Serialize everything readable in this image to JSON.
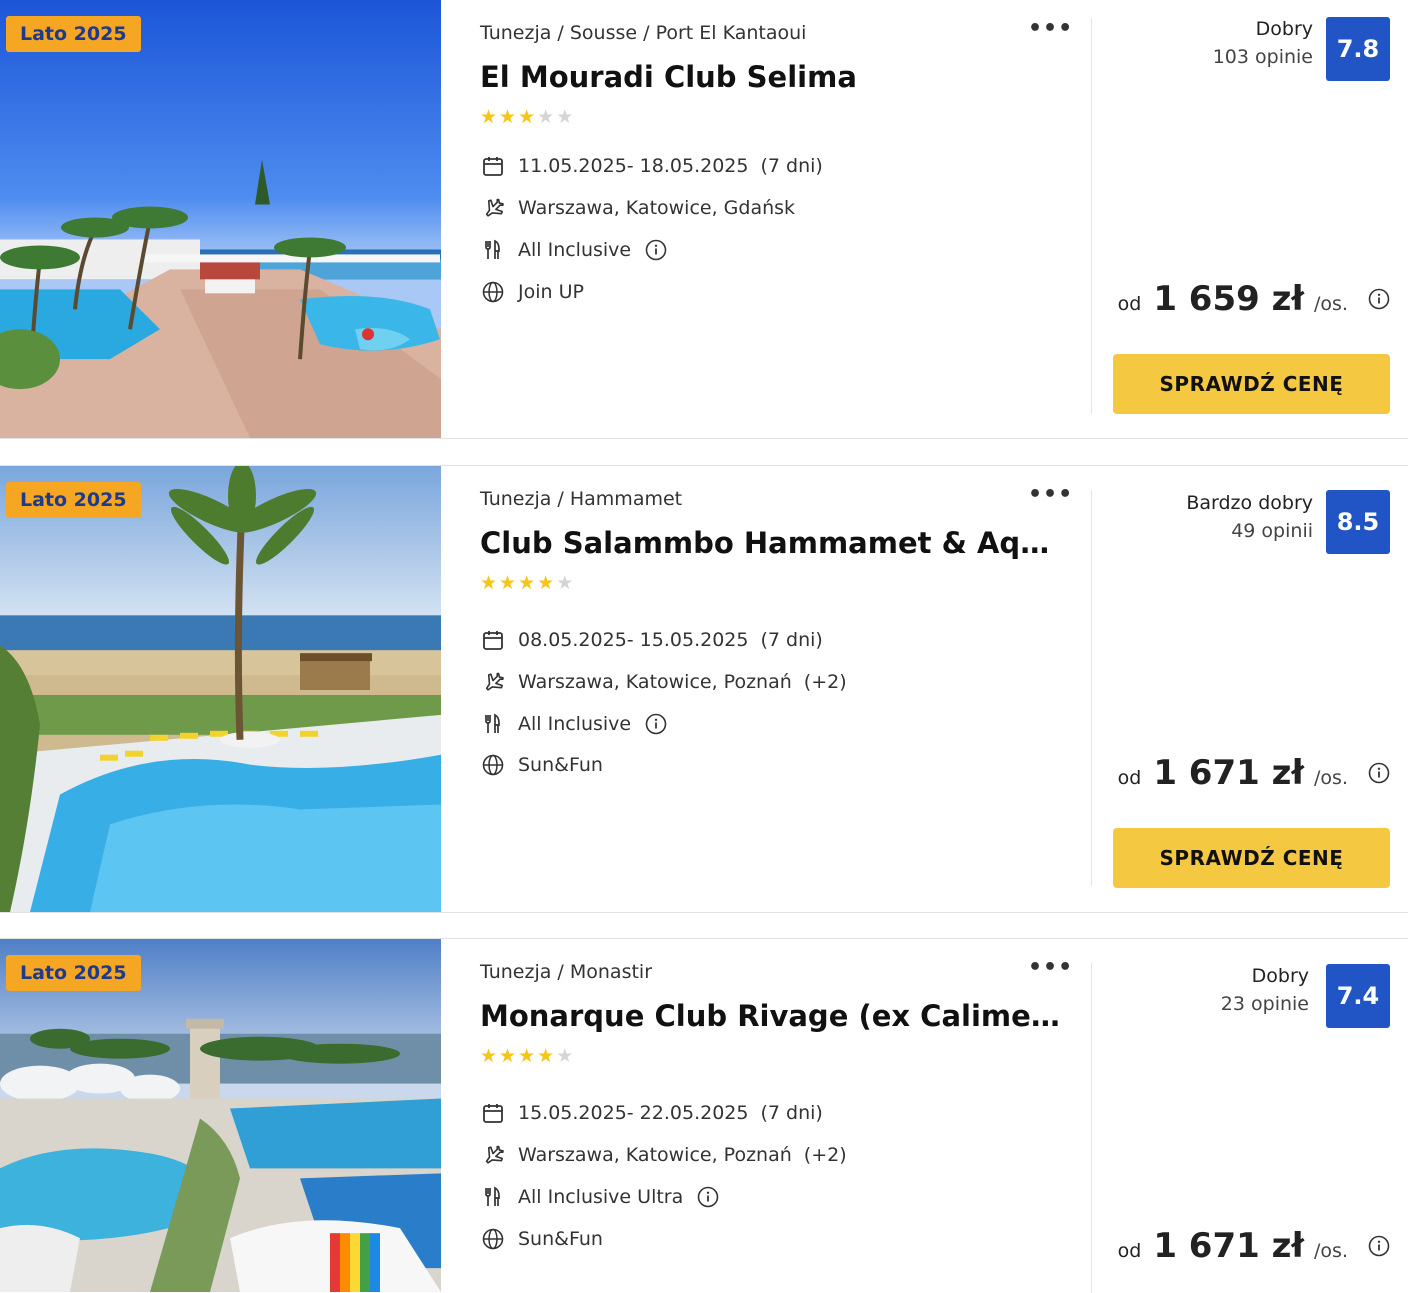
{
  "offers": [
    {
      "badge": "Lato 2025",
      "location": "Tunezja / Sousse / Port El Kantaoui",
      "name": "El Mouradi Club Selima",
      "stars": 3,
      "dates": "11.05.2025- 18.05.2025",
      "duration": "(7 dni)",
      "airports": "Warszawa, Katowice, Gdańsk",
      "airports_extra": "",
      "board": "All Inclusive",
      "organizer": "Join UP",
      "rating_label": "Dobry",
      "rating_count": "103 opinie",
      "score": "7.8",
      "price_prefix": "od",
      "price": "1 659 zł",
      "price_unit": "/os.",
      "button_label": "SPRAWDŹ CENĘ"
    },
    {
      "badge": "Lato 2025",
      "location": "Tunezja / Hammamet",
      "name": "Club Salammbo Hammamet & Aqua Park",
      "stars": 4,
      "dates": "08.05.2025- 15.05.2025",
      "duration": "(7 dni)",
      "airports": "Warszawa, Katowice, Poznań",
      "airports_extra": "(+2)",
      "board": "All Inclusive",
      "organizer": "Sun&Fun",
      "rating_label": "Bardzo dobry",
      "rating_count": "49 opinii",
      "score": "8.5",
      "price_prefix": "od",
      "price": "1 671 zł",
      "price_unit": "/os.",
      "button_label": "SPRAWDŹ CENĘ"
    },
    {
      "badge": "Lato 2025",
      "location": "Tunezja / Monastir",
      "name": "Monarque Club Rivage (ex Calimera)",
      "stars": 4,
      "dates": "15.05.2025- 22.05.2025",
      "duration": "(7 dni)",
      "airports": "Warszawa, Katowice, Poznań",
      "airports_extra": "(+2)",
      "board": "All Inclusive Ultra",
      "organizer": "Sun&Fun",
      "rating_label": "Dobry",
      "rating_count": "23 opinie",
      "score": "7.4",
      "price_prefix": "od",
      "price": "1 671 zł",
      "price_unit": "/os.",
      "button_label": ""
    }
  ],
  "colors": {
    "badge_bg": "#f5a623",
    "badge_text": "#1e3a8a",
    "score_bg": "#2154c5",
    "button_bg": "#f5c842",
    "star_on": "#f5c518",
    "star_off": "#d5d5d5"
  },
  "icons": {
    "favorite": "heart-outline-icon",
    "more": "more-horizontal-icon",
    "dates": "calendar-icon",
    "flight": "plane-icon",
    "board": "cutlery-icon",
    "organizer": "globe-icon",
    "info": "info-circle-icon"
  }
}
